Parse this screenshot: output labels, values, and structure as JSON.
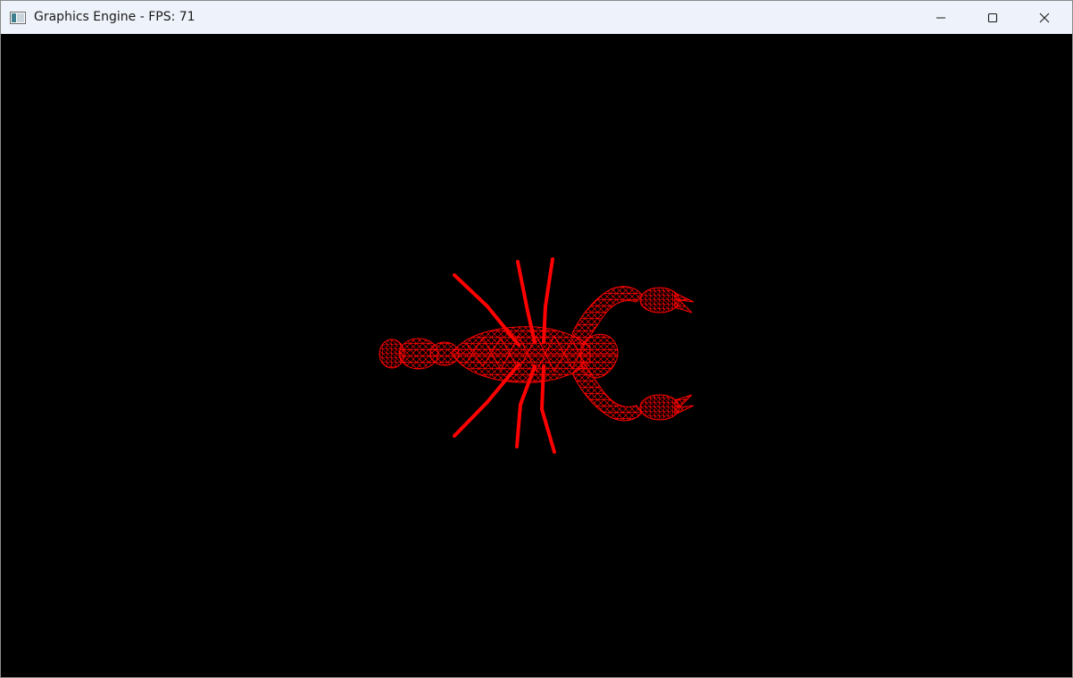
{
  "window": {
    "title": "Graphics Engine - FPS: 71",
    "controls": {
      "minimize": "minimize",
      "maximize": "maximize",
      "close": "close"
    }
  },
  "scene": {
    "background_color": "#000000",
    "wireframe_color": "#ff0000",
    "render_mode": "wireframe",
    "model": "scorpion"
  }
}
